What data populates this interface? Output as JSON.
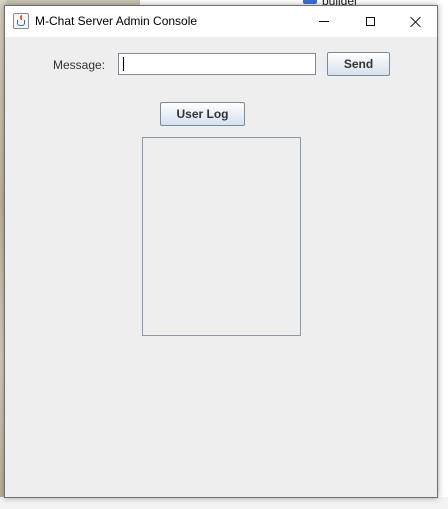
{
  "window": {
    "title": "M-Chat Server Admin Console"
  },
  "desktop": {
    "folder_label": "builder"
  },
  "form": {
    "message_label": "Message:",
    "message_value": "",
    "send_label": "Send",
    "user_log_label": "User Log"
  },
  "icons": {
    "app": "java-cup-icon",
    "minimize": "minimize-icon",
    "maximize": "maximize-icon",
    "close": "close-icon"
  },
  "colors": {
    "window_bg": "#eeeeee",
    "titlebar_bg": "#ffffff",
    "button_border": "#7a8a99"
  }
}
